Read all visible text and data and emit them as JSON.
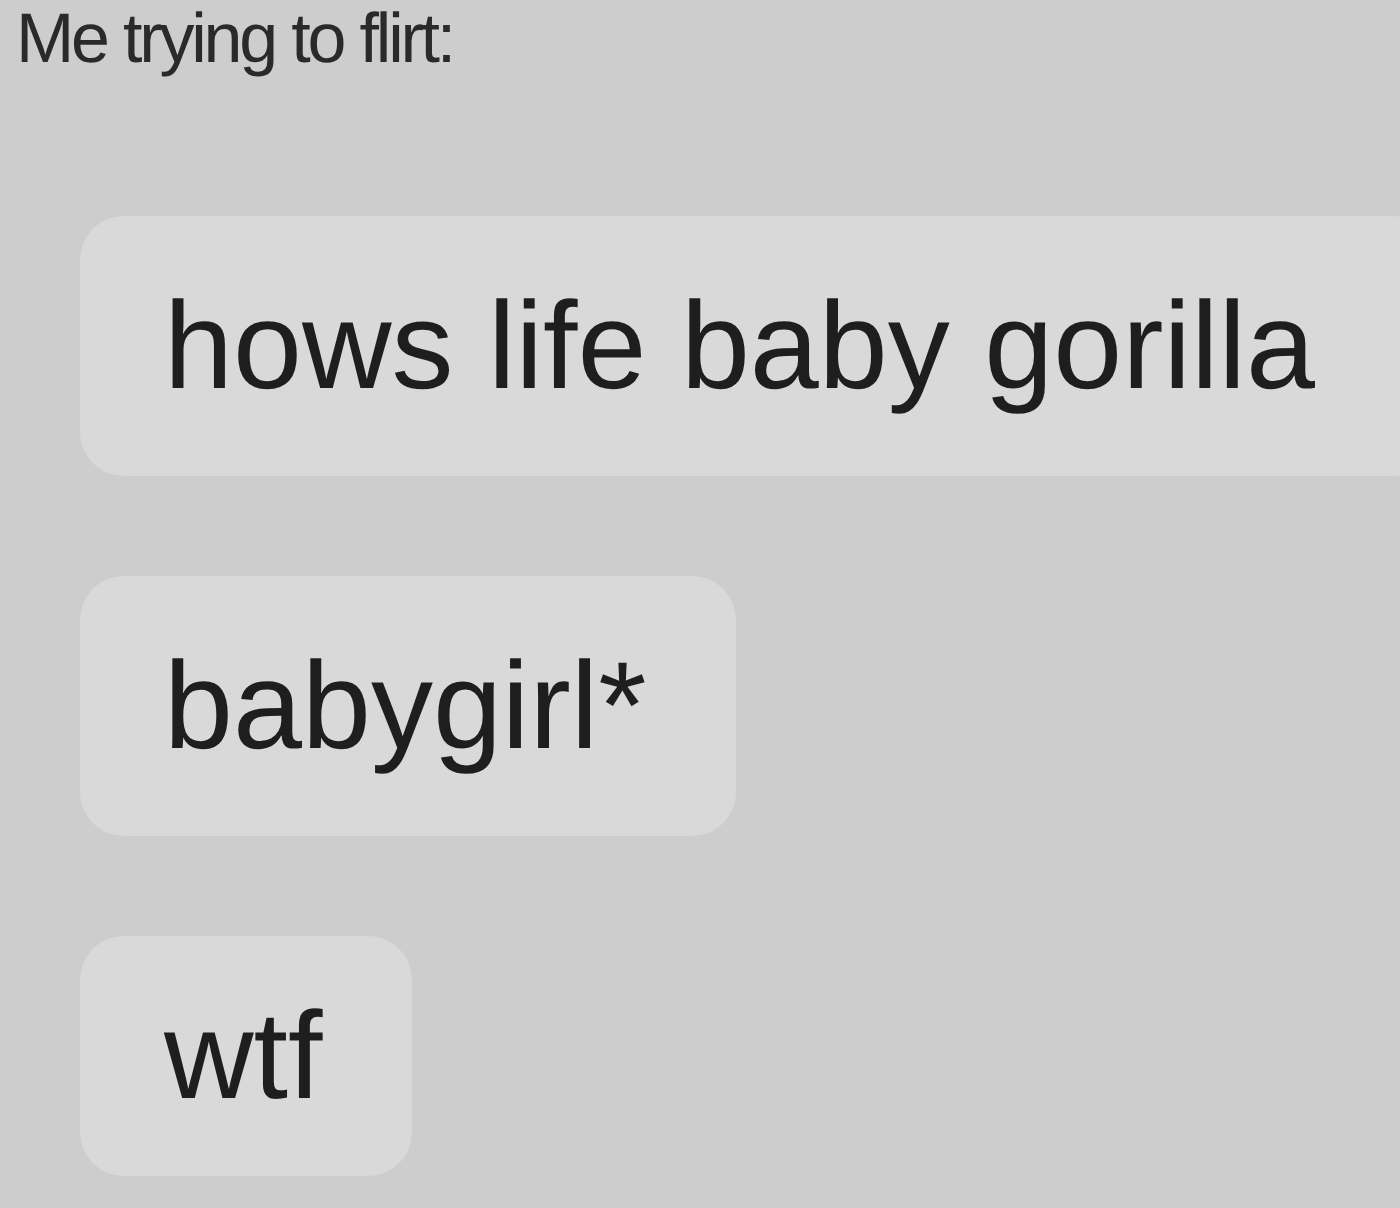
{
  "caption": "Me trying to flirt:",
  "messages": [
    {
      "text": "hows life baby gorilla"
    },
    {
      "text": "babygirl*"
    },
    {
      "text": "wtf"
    }
  ]
}
